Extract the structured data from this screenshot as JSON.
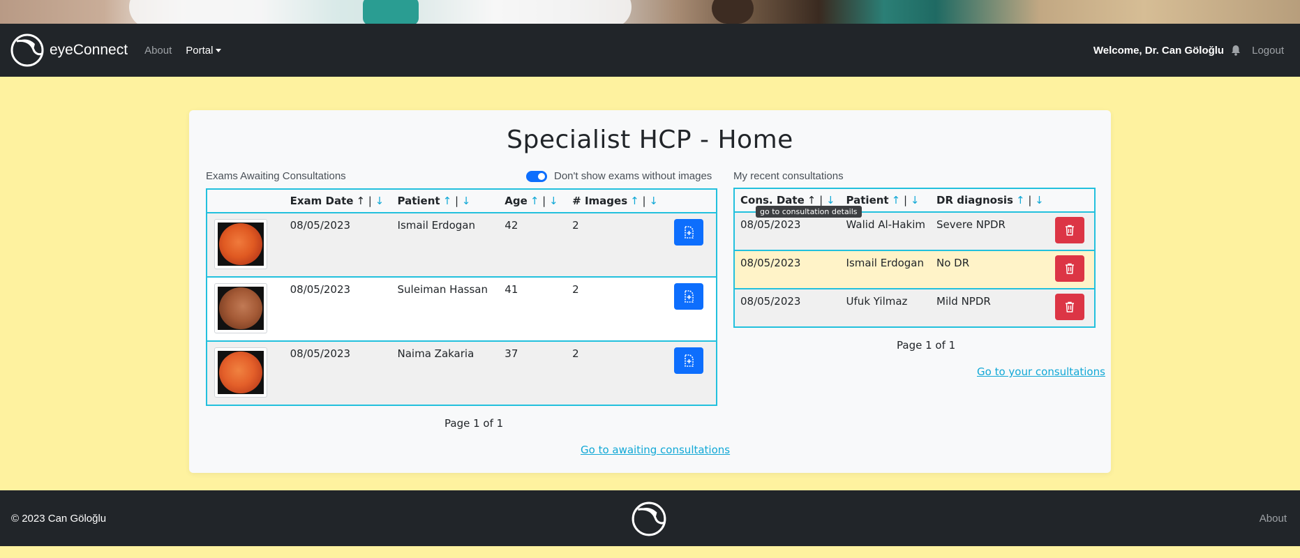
{
  "app": {
    "brand": "eyeConnect"
  },
  "nav": {
    "about": "About",
    "portal": "Portal",
    "welcome": "Welcome, Dr. Can Göloğlu",
    "logout": "Logout"
  },
  "page": {
    "title": "Specialist HCP - Home"
  },
  "awaiting": {
    "label": "Exams Awaiting Consultations",
    "toggle_label": "Don't show exams without images",
    "toggle_on": true,
    "columns": [
      "Exam Date",
      "Patient",
      "Age",
      "# Images"
    ],
    "sort_up": "↑",
    "sort_sep": "|",
    "sort_down": "↓",
    "rows": [
      {
        "date": "08/05/2023",
        "patient": "Ismail Erdogan",
        "age": "42",
        "images": "2"
      },
      {
        "date": "08/05/2023",
        "patient": "Suleiman Hassan",
        "age": "41",
        "images": "2"
      },
      {
        "date": "08/05/2023",
        "patient": "Naima Zakaria",
        "age": "37",
        "images": "2"
      }
    ],
    "pager": "Page 1 of 1",
    "link": "Go to awaiting consultations"
  },
  "recent": {
    "label": "My recent consultations",
    "columns": [
      "Cons. Date",
      "Patient",
      "DR diagnosis"
    ],
    "rows": [
      {
        "date": "08/05/2023",
        "patient": "Walid Al-Hakim",
        "diagnosis": "Severe NPDR"
      },
      {
        "date": "08/05/2023",
        "patient": "Ismail Erdogan",
        "diagnosis": "No DR"
      },
      {
        "date": "08/05/2023",
        "patient": "Ufuk Yilmaz",
        "diagnosis": "Mild NPDR"
      }
    ],
    "tooltip": "go to consultation details",
    "pager": "Page 1 of 1",
    "link": "Go to your consultations"
  },
  "footer": {
    "copyright": "© 2023 Can Göloğlu",
    "about": "About"
  },
  "colors": {
    "page_bg": "#fef29f",
    "navbar": "#212529",
    "table_border": "#22c0dd",
    "primary": "#0d6efd",
    "danger": "#dc3545",
    "link": "#11a8d6"
  }
}
